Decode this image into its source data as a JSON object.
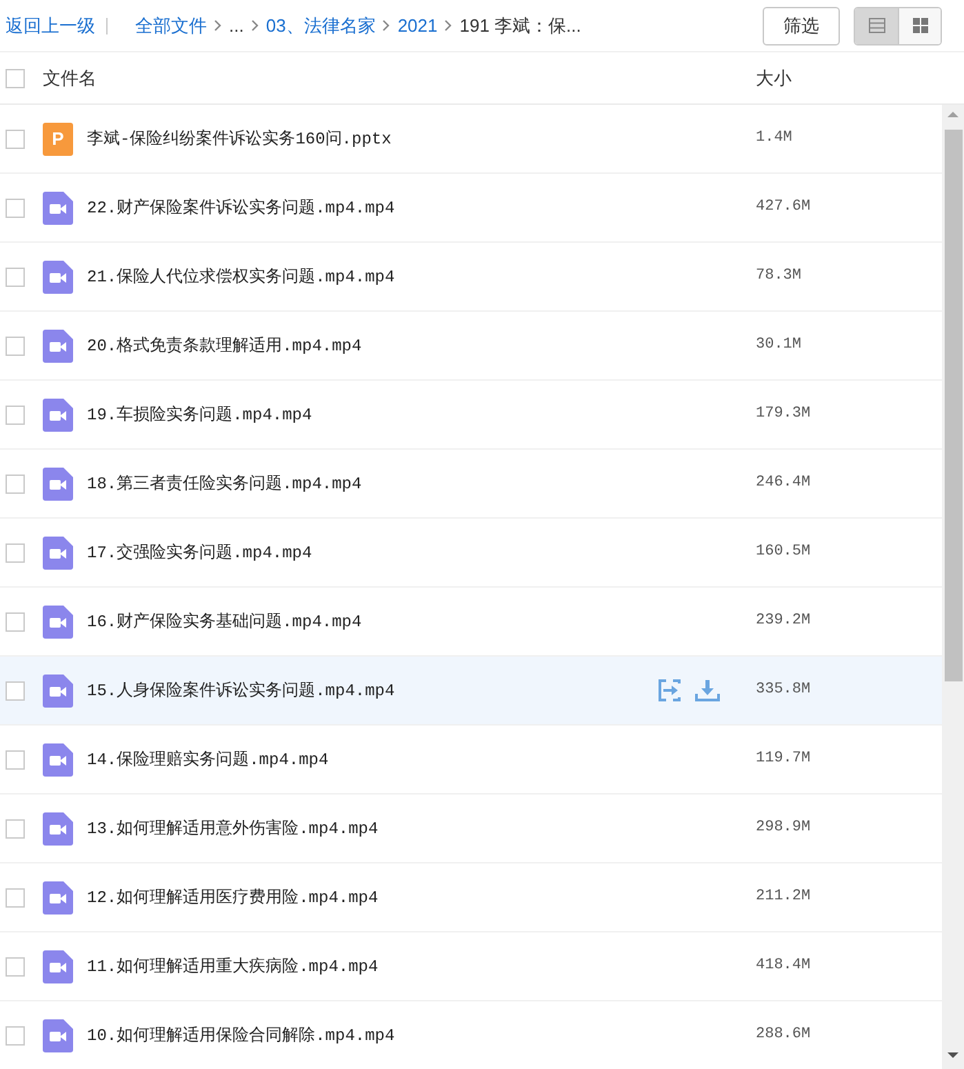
{
  "toolbar": {
    "back_link": "返回上一级",
    "breadcrumbs": [
      {
        "label": "全部文件",
        "kind": "link"
      },
      {
        "label": "...",
        "kind": "text"
      },
      {
        "label": "03、法律名家",
        "kind": "link"
      },
      {
        "label": "2021",
        "kind": "link"
      },
      {
        "label": "191 李斌：保...",
        "kind": "text"
      }
    ],
    "filter_button": "筛选",
    "view_modes": [
      {
        "kind": "list",
        "selected": true
      },
      {
        "kind": "grid",
        "selected": false
      }
    ]
  },
  "columns": {
    "select_all": {
      "checked": false
    },
    "name": "文件名",
    "size": "大小"
  },
  "rows": [
    {
      "kind": "pptx",
      "icon_letter": "P",
      "name": "李斌-保险纠纷案件诉讼实务160问.pptx",
      "size": "1.4M",
      "checked": false,
      "hovered": false
    },
    {
      "kind": "video",
      "name": "22.财产保险案件诉讼实务问题.mp4.mp4",
      "size": "427.6M",
      "checked": false,
      "hovered": false
    },
    {
      "kind": "video",
      "name": "21.保险人代位求偿权实务问题.mp4.mp4",
      "size": "78.3M",
      "checked": false,
      "hovered": false
    },
    {
      "kind": "video",
      "name": "20.格式免责条款理解适用.mp4.mp4",
      "size": "30.1M",
      "checked": false,
      "hovered": false
    },
    {
      "kind": "video",
      "name": "19.车损险实务问题.mp4.mp4",
      "size": "179.3M",
      "checked": false,
      "hovered": false
    },
    {
      "kind": "video",
      "name": "18.第三者责任险实务问题.mp4.mp4",
      "size": "246.4M",
      "checked": false,
      "hovered": false
    },
    {
      "kind": "video",
      "name": "17.交强险实务问题.mp4.mp4",
      "size": "160.5M",
      "checked": false,
      "hovered": false
    },
    {
      "kind": "video",
      "name": "16.财产保险实务基础问题.mp4.mp4",
      "size": "239.2M",
      "checked": false,
      "hovered": false
    },
    {
      "kind": "video",
      "name": "15.人身保险案件诉讼实务问题.mp4.mp4",
      "size": "335.8M",
      "checked": false,
      "hovered": true
    },
    {
      "kind": "video",
      "name": "14.保险理赔实务问题.mp4.mp4",
      "size": "119.7M",
      "checked": false,
      "hovered": false
    },
    {
      "kind": "video",
      "name": "13.如何理解适用意外伤害险.mp4.mp4",
      "size": "298.9M",
      "checked": false,
      "hovered": false
    },
    {
      "kind": "video",
      "name": "12.如何理解适用医疗费用险.mp4.mp4",
      "size": "211.2M",
      "checked": false,
      "hovered": false
    },
    {
      "kind": "video",
      "name": "11.如何理解适用重大疾病险.mp4.mp4",
      "size": "418.4M",
      "checked": false,
      "hovered": false
    },
    {
      "kind": "video",
      "name": "10.如何理解适用保险合同解除.mp4.mp4",
      "size": "288.6M",
      "checked": false,
      "hovered": false
    }
  ]
}
